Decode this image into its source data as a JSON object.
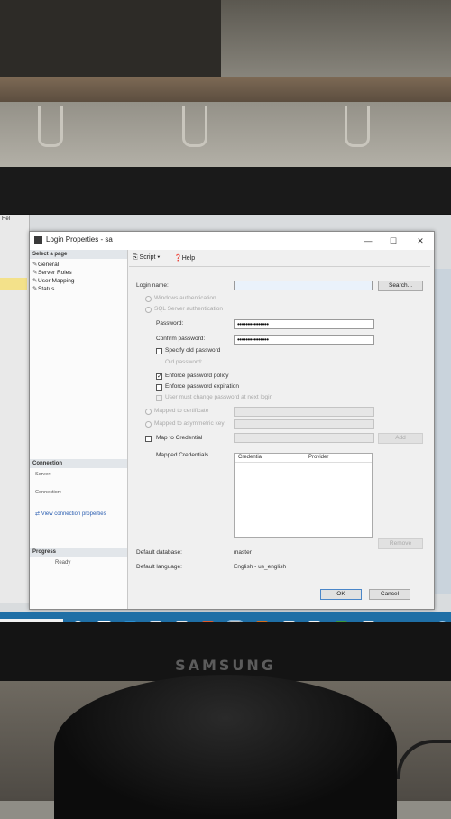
{
  "dialog": {
    "title": "Login Properties - sa",
    "pages_header": "Select a page",
    "pages": [
      "General",
      "Server Roles",
      "User Mapping",
      "Status"
    ],
    "toolbar": {
      "script": "Script",
      "help": "Help"
    },
    "connection_header": "Connection",
    "connection_server_label": "Server:",
    "connection_connection_label": "Connection:",
    "connection_link": "View connection properties",
    "progress_header": "Progress",
    "progress_status": "Ready"
  },
  "general": {
    "login_name_label": "Login name:",
    "search_button": "Search...",
    "windows_auth_label": "Windows authentication",
    "sql_auth_label": "SQL Server authentication",
    "password_label": "Password:",
    "password_value": "•••••••••••••••",
    "confirm_password_label": "Confirm password:",
    "confirm_password_value": "•••••••••••••••",
    "specify_old_password_label": "Specify old password",
    "old_password_label": "Old password:",
    "enforce_policy_label": "Enforce password policy",
    "enforce_expiration_label": "Enforce password expiration",
    "must_change_label": "User must change password at next login",
    "mapped_cert_label": "Mapped to certificate",
    "mapped_key_label": "Mapped to asymmetric key",
    "map_credential_label": "Map to Credential",
    "add_button": "Add",
    "mapped_credentials_label": "Mapped Credentials",
    "grid_col_credential": "Credential",
    "grid_col_provider": "Provider",
    "remove_button": "Remove",
    "default_database_label": "Default database:",
    "default_database_value": "master",
    "default_language_label": "Default language:",
    "default_language_value": "English - us_english"
  },
  "buttons": {
    "ok": "OK",
    "cancel": "Cancel"
  },
  "monitor": {
    "brand": "SAMSUNG"
  },
  "colors": {
    "taskbar": "#1f6fa6",
    "dialog_bg": "#f0f0f0",
    "selection": "#f3e18a"
  }
}
